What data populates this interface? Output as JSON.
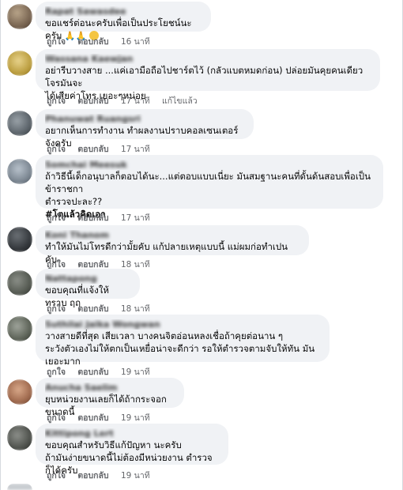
{
  "comments": [
    {
      "name": "Rapat Sawasdee",
      "text": [
        "ขอแชร์ต่อนะครับเพื่อเป็นประโยชน์นะครับ"
      ],
      "emoji": [
        "folded-hands-icon",
        "folded-hands-icon",
        "smiling-face-icon"
      ],
      "like": "ถูกใจ",
      "reply": "ตอบกลับ",
      "time": "16 นาที",
      "edited": ""
    },
    {
      "name": "Wassana Kaewjan",
      "text": [
        "อย่ารีบวางสาย ...แค่เอามือถือไปชาร์ตไว้ (กลัวแบตหมดก่อน) ปล่อยมันคุยคนเดียว โจรมันจะ",
        "ได้เสียค่าโทร.เยอะๆหน่อย"
      ],
      "like": "ถูกใจ",
      "reply": "ตอบกลับ",
      "time": "17 นาที",
      "edited": "แก้ไขแล้ว"
    },
    {
      "name": "Phanuwat Ruangsri",
      "text": [
        "อยากเห็นการทำงาน ทำผลงานปราบคอลเซนเตอร์จังครับ"
      ],
      "like": "ถูกใจ",
      "reply": "ตอบกลับ",
      "time": "17 นาที",
      "edited": ""
    },
    {
      "name": "Somchai Meesuk",
      "text": [
        "ถ้าวิธีนี้เด็กอนุบาลก็ตอบได้นะ...แต่ตอบแบบเนี่ยะ มันสมฐานะคนที่ดั้นด้นสอบเพื่อเป็นข้าราชกา",
        "ตำรวจปะละ??"
      ],
      "tag": "#โตแล้วคิดเอา",
      "like": "ถูกใจ",
      "reply": "ตอบกลับ",
      "time": "17 นาที",
      "edited": ""
    },
    {
      "name": "Koni Thanom",
      "text": [
        "ทำให้มันไม่โทรดีกว่ามั้ยคับ แก้ปลายเหตุแบบนี้ แม่ผมก่อทำเปนคับ"
      ],
      "like": "ถูกใจ",
      "reply": "ตอบกลับ",
      "time": "18 นาที",
      "edited": ""
    },
    {
      "name": "Nattapong",
      "text": [
        "ขอบคุณที่แจ้งให้ทราบ ฤฤ"
      ],
      "like": "ถูกใจ",
      "reply": "ตอบกลับ",
      "time": "18 นาที",
      "edited": ""
    },
    {
      "name": "Suthilai Jaika Wongwan",
      "text": [
        "วางสายดีที่สุด เสียเวลา บางคนจิตอ่อนหลงเชื่อถ้าคุยต่อนาน ๆ",
        "ระวังตัวเองไม่ให้ตกเป็นเหยื่อน่าจะดีกว่า รอให้ตำรวจตามจับให้ทัน มันเยอะมาก"
      ],
      "like": "ถูกใจ",
      "reply": "ตอบกลับ",
      "time": "19 นาที",
      "edited": ""
    },
    {
      "name": "Anucha Saelim",
      "text": [
        "ยุบหน่วยงานเลยก็ได้ถ้ากระจอกขนาดนี้"
      ],
      "like": "ถูกใจ",
      "reply": "ตอบกลับ",
      "time": "19 นาที",
      "edited": ""
    },
    {
      "name": "Kittipong Lert",
      "text": [
        "ขอบคุณสำหรับวิธีแก้ปัญหา นะครับ",
        "ถ้ามันง่ายขนาดนี้ไม่ต้องมีหน่วยงาน ตำรวจก็ได้ครับ"
      ],
      "like": "ถูกใจ",
      "reply": "ตอบกลับ",
      "time": "19 นาที",
      "edited": ""
    }
  ]
}
